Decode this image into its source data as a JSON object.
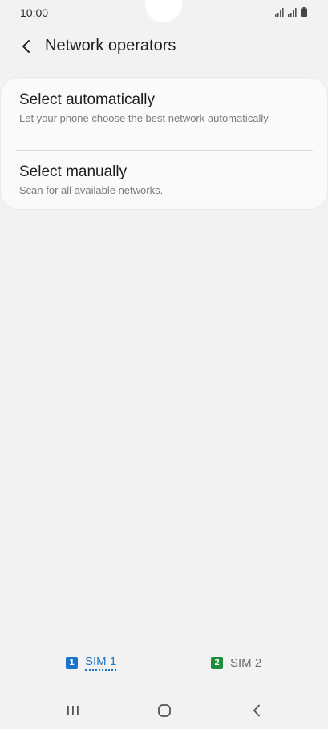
{
  "status_bar": {
    "time": "10:00",
    "icons": [
      "signal-sim1-icon",
      "signal-sim2-icon",
      "battery-icon"
    ]
  },
  "header": {
    "back_icon": "chevron-left-icon",
    "title": "Network operators"
  },
  "options": [
    {
      "title": "Select automatically",
      "subtitle": "Let your phone choose the best network automatically."
    },
    {
      "title": "Select manually",
      "subtitle": "Scan for all available networks."
    }
  ],
  "sim_tabs": [
    {
      "badge": "1",
      "label": "SIM 1",
      "color": "#1a73c8",
      "selected": true
    },
    {
      "badge": "2",
      "label": "SIM 2",
      "color": "#1e8e3e",
      "selected": false
    }
  ],
  "nav_bar": {
    "icons": [
      "recent-apps-icon",
      "home-icon",
      "back-icon"
    ]
  },
  "colors": {
    "background": "#f2f2f2",
    "card": "#fafafa",
    "accent": "#1a73c8"
  }
}
